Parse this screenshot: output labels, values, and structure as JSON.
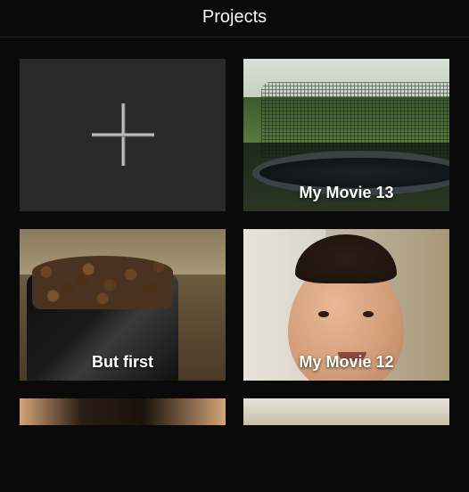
{
  "header": {
    "title": "Projects"
  },
  "projects": [
    {
      "label": "My Movie 13"
    },
    {
      "label": "But first"
    },
    {
      "label": "My Movie 12"
    }
  ]
}
